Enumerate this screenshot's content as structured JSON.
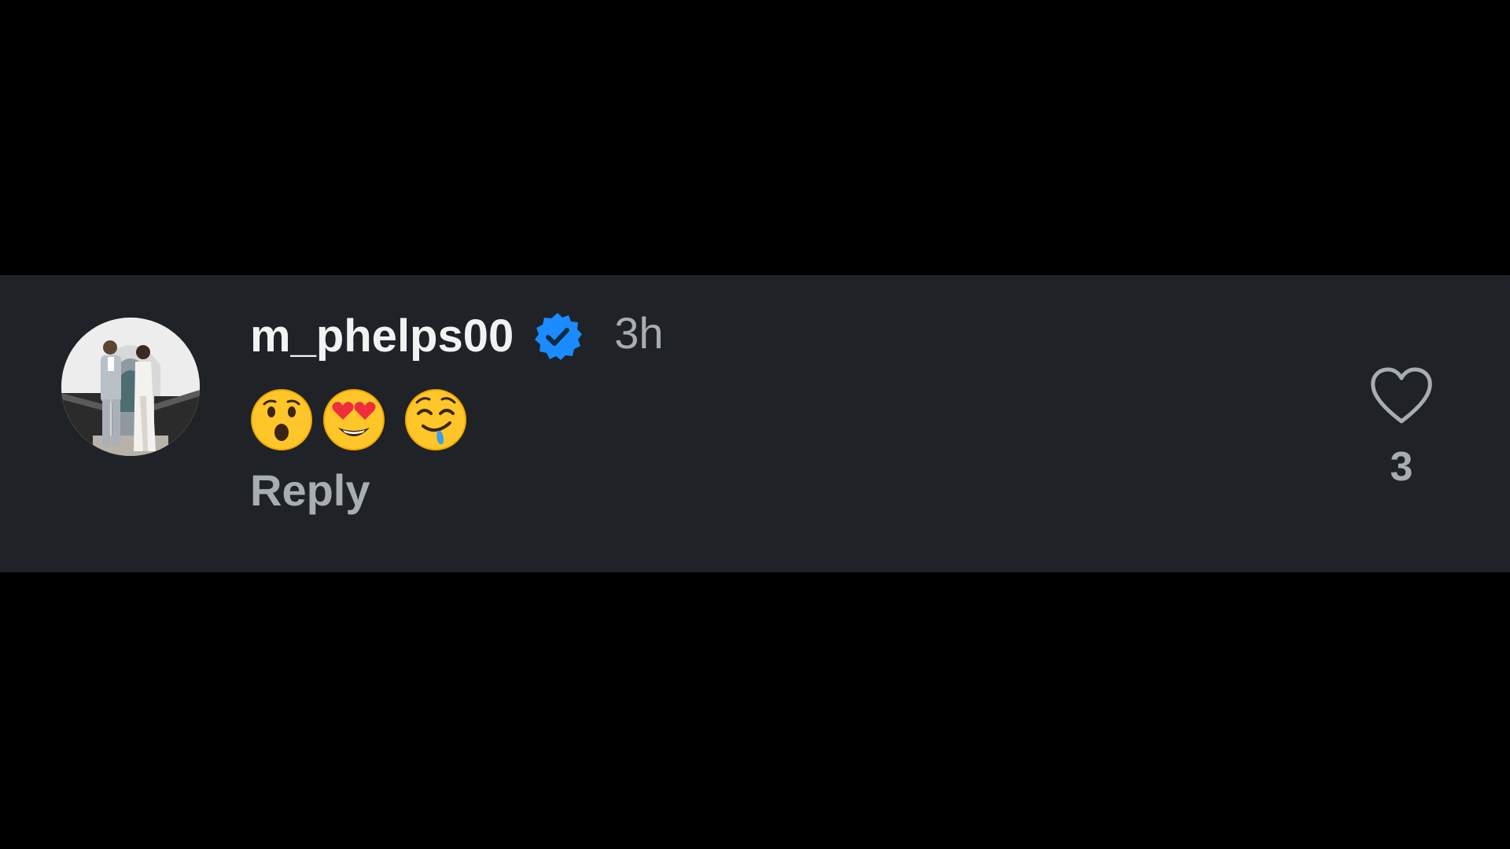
{
  "comment": {
    "username": "m_phelps00",
    "verified": true,
    "timestamp": "3h",
    "emojis": [
      "astonished-face",
      "smiling-face-with-heart-eyes",
      "drooling-face"
    ],
    "reply_label": "Reply",
    "like_count": "3"
  },
  "icons": {
    "verified": "verified-badge-icon",
    "like": "heart-icon"
  },
  "colors": {
    "background": "#000000",
    "card": "#1f2227",
    "username": "#f2f2f2",
    "muted": "#a8adb3",
    "verified_blue": "#1a8cff"
  }
}
